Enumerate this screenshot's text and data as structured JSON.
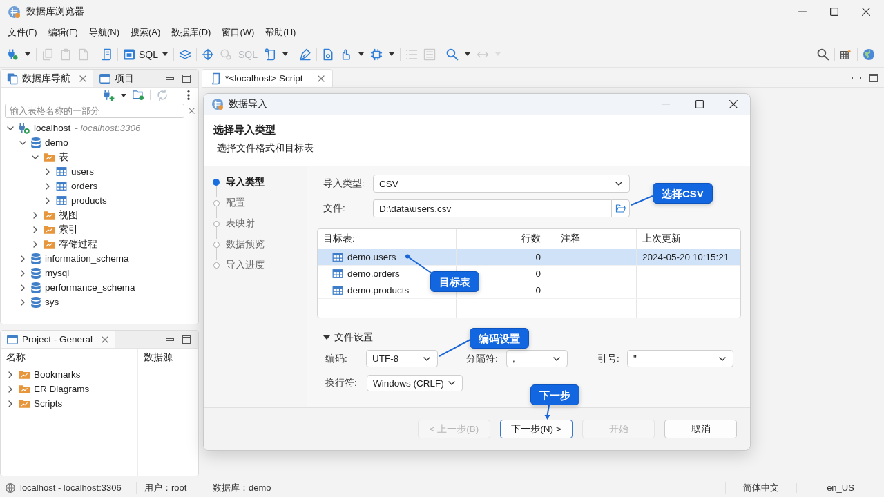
{
  "window": {
    "title": "数据库浏览器"
  },
  "menu": [
    "文件(F)",
    "编辑(E)",
    "导航(N)",
    "搜索(A)",
    "数据库(D)",
    "窗口(W)",
    "帮助(H)"
  ],
  "toolbar": {
    "left": [
      [
        {
          "kind": "icon",
          "disabled": false,
          "dropdown": true
        }
      ],
      [
        {
          "kind": "icon",
          "disabled": true
        },
        {
          "kind": "icon",
          "disabled": true
        },
        {
          "kind": "icon",
          "disabled": true
        }
      ],
      [
        {
          "kind": "icon",
          "disabled": false
        }
      ],
      [
        {
          "kind": "icon_label",
          "label": "SQL",
          "disabled": false,
          "dropdown": true
        }
      ],
      [
        {
          "kind": "icon",
          "disabled": false
        }
      ],
      [
        {
          "kind": "icon",
          "disabled": false
        },
        {
          "kind": "icon",
          "disabled": true
        },
        {
          "kind": "label",
          "label": "SQL",
          "disabled": true
        },
        {
          "kind": "icon",
          "disabled": false,
          "dropdown": true
        }
      ],
      [
        {
          "kind": "icon",
          "disabled": false
        }
      ],
      [
        {
          "kind": "icon",
          "disabled": false
        },
        {
          "kind": "icon",
          "disabled": false,
          "dropdown": true
        },
        {
          "kind": "icon",
          "disabled": false,
          "dropdown": true
        }
      ],
      [
        {
          "kind": "icon",
          "disabled": true
        },
        {
          "kind": "icon",
          "disabled": true
        }
      ],
      [
        {
          "kind": "icon",
          "disabled": false,
          "dropdown": true
        },
        {
          "kind": "icon",
          "disabled": true,
          "dropdown": true
        }
      ]
    ],
    "right": [
      [
        {
          "kind": "icon",
          "disabled": false
        }
      ],
      [
        {
          "kind": "icon",
          "disabled": false
        }
      ],
      [
        {
          "kind": "icon",
          "disabled": false
        }
      ]
    ]
  },
  "navigator": {
    "tabs": [
      {
        "label": "数据库导航",
        "selected": true,
        "closable": true
      },
      {
        "label": "项目",
        "selected": false
      }
    ],
    "filter": {
      "placeholder": "输入表格名称的一部分"
    },
    "tree": [
      {
        "label": "localhost",
        "detail": "- localhost:3306",
        "kind": "connection",
        "expanded": true,
        "children": [
          {
            "label": "demo",
            "kind": "database",
            "expanded": true,
            "children": [
              {
                "label": "表",
                "kind": "folder",
                "expanded": true,
                "children": [
                  {
                    "label": "users",
                    "kind": "table",
                    "expanded": false
                  },
                  {
                    "label": "orders",
                    "kind": "table",
                    "expanded": false
                  },
                  {
                    "label": "products",
                    "kind": "table",
                    "expanded": false
                  }
                ]
              },
              {
                "label": "视图",
                "kind": "folder",
                "expanded": false
              },
              {
                "label": "索引",
                "kind": "folder",
                "expanded": false
              },
              {
                "label": "存储过程",
                "kind": "folder",
                "expanded": false
              }
            ]
          },
          {
            "label": "information_schema",
            "kind": "database",
            "expanded": false
          },
          {
            "label": "mysql",
            "kind": "database",
            "expanded": false
          },
          {
            "label": "performance_schema",
            "kind": "database",
            "expanded": false
          },
          {
            "label": "sys",
            "kind": "database",
            "expanded": false
          }
        ]
      }
    ]
  },
  "project_panel": {
    "tabs": [
      {
        "label": "Project - General",
        "selected": true,
        "closable": true
      }
    ],
    "columns": [
      "名称",
      "数据源"
    ],
    "tree": [
      {
        "label": "Bookmarks",
        "kind": "folder",
        "expanded": false
      },
      {
        "label": "ER Diagrams",
        "kind": "folder",
        "expanded": false
      },
      {
        "label": "Scripts",
        "kind": "folder",
        "expanded": false
      }
    ]
  },
  "editor": {
    "tabs": [
      {
        "label": "*<localhost> Script",
        "selected": true,
        "closable": true
      }
    ]
  },
  "dialog": {
    "title": "数据导入",
    "heading": "选择导入类型",
    "subheading": "选择文件格式和目标表",
    "steps": [
      {
        "label": "导入类型",
        "selected": true
      },
      {
        "label": "配置",
        "selected": false
      },
      {
        "label": "表映射",
        "selected": false
      },
      {
        "label": "数据预览",
        "selected": false
      },
      {
        "label": "导入进度",
        "selected": false
      }
    ],
    "import_type": {
      "label": "导入类型:",
      "value": "CSV"
    },
    "file": {
      "label": "文件:",
      "value": "D:\\data\\users.csv"
    },
    "table": {
      "columns": [
        "目标表:",
        "行数",
        "注释",
        "上次更新"
      ],
      "rows": [
        {
          "name": "demo.users",
          "rows": "0",
          "updated": "2024-05-20 10:15:21",
          "selected": true
        },
        {
          "name": "demo.orders",
          "rows": "0",
          "selected": false
        },
        {
          "name": "demo.products",
          "rows": "0",
          "selected": false
        }
      ]
    },
    "file_settings": {
      "label": "文件设置",
      "expanded": true,
      "fields": [
        {
          "label": "编码:",
          "value": "UTF-8"
        },
        {
          "label": "分隔符:",
          "value": ","
        },
        {
          "label": "引号:",
          "value": "\""
        },
        {
          "label": "换行符:",
          "value": "Windows (CRLF)"
        }
      ]
    },
    "buttons": [
      {
        "label": "< 上一步(B)",
        "disabled": true,
        "default": false
      },
      {
        "label": "下一步(N) >",
        "disabled": false,
        "default": true
      },
      {
        "label": "开始",
        "disabled": true,
        "default": false
      },
      {
        "label": "取消",
        "disabled": false,
        "default": false
      }
    ]
  },
  "annotations": [
    {
      "text": "选择CSV"
    },
    {
      "text": "目标表"
    },
    {
      "text": "编码设置"
    },
    {
      "text": "下一步"
    }
  ],
  "status_bar": {
    "connection": "localhost - localhost:3306",
    "user": "用户：root",
    "database": "数据库：demo",
    "language": "简体中文",
    "locale": "en_US"
  }
}
